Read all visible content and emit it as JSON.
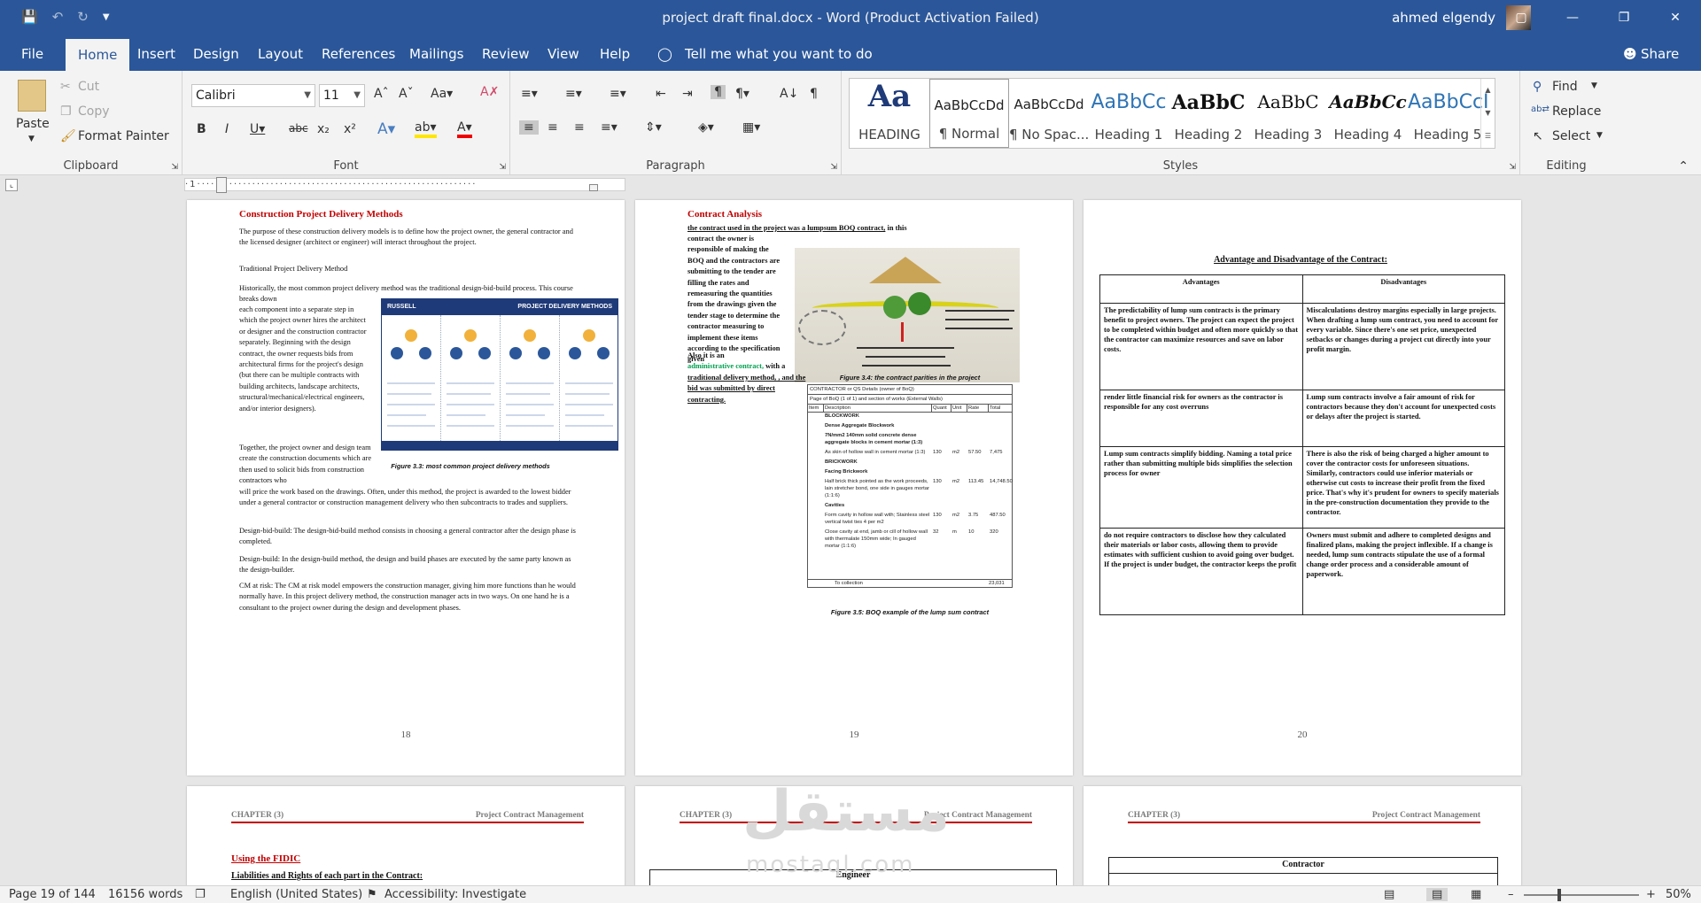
{
  "window": {
    "title": "project draft final.docx  -  Word (Product Activation Failed)",
    "user": "ahmed elgendy"
  },
  "tabs": [
    "File",
    "Home",
    "Insert",
    "Design",
    "Layout",
    "References",
    "Mailings",
    "Review",
    "View",
    "Help"
  ],
  "tell_me": "Tell me what you want to do",
  "share": "Share",
  "clipboard": {
    "paste": "Paste",
    "cut": "Cut",
    "copy": "Copy",
    "format_painter": "Format Painter",
    "label": "Clipboard"
  },
  "font": {
    "name": "Calibri",
    "size": "11",
    "label": "Font"
  },
  "paragraph": {
    "label": "Paragraph"
  },
  "styles": {
    "label": "Styles",
    "items": [
      {
        "preview": "Aa",
        "name": "HEADING"
      },
      {
        "preview": "AaBbCcDd",
        "name": "¶ Normal"
      },
      {
        "preview": "AaBbCcDd",
        "name": "¶ No Spac..."
      },
      {
        "preview": "AaBbCc",
        "name": "Heading 1"
      },
      {
        "preview": "AaBbC",
        "name": "Heading 2"
      },
      {
        "preview": "AaBbC",
        "name": "Heading 3"
      },
      {
        "preview": "AaBbCc",
        "name": "Heading 4"
      },
      {
        "preview": "AaBbCcI",
        "name": "Heading 5"
      }
    ]
  },
  "editing": {
    "find": "Find",
    "replace": "Replace",
    "select": "Select",
    "label": "Editing"
  },
  "page18": {
    "title": "Construction Project Delivery Methods",
    "intro": "The purpose of these construction delivery models is to define how the project owner, the general contractor and the licensed designer (architect or engineer) will interact throughout the project.",
    "sub": "Traditional Project Delivery Method",
    "p1a": "Historically, the most common project delivery method was the traditional design-bid-build process. This course breaks down",
    "p1b": "each component into a separate step in which the project owner hires the architect or designer and the construction contractor separately. Beginning with the design contract, the owner requests bids from architectural firms for the project's design (but there can be multiple contracts with building architects, landscape architects, structural/mechanical/electrical engineers, and/or interior designers).",
    "p2a": "Together, the project owner and design team create the construction documents which are then used to solicit bids from construction contractors who",
    "p2b": "will price the work based on the drawings. Often, under this method, the project is awarded to the lowest bidder under a general contractor or construction management delivery who then subcontracts to trades and suppliers.",
    "p3": "Design-bid-build: The design-bid-build method consists in choosing a general contractor after the design phase is completed.",
    "p4": "Design-build: In the design-build method, the design and build phases are executed by the same party known as the design-builder.",
    "p5": "CM at risk: The CM at risk model empowers the construction manager, giving him more functions than he would normally have. In this project delivery method, the construction manager acts in two ways. On one hand he is a consultant to the project owner during the design and development phases.",
    "figure": {
      "brand": "RUSSELL",
      "heading": "PROJECT DELIVERY METHODS"
    },
    "caption": "Figure 3.3: most common project delivery methods",
    "num": "18"
  },
  "page19": {
    "title": "Contract Analysis",
    "lead_u": "the contract used in the project was a lumpsum BOQ contract,",
    "lead_rest": " in this",
    "body": "contract the owner is responsible of making the BOQ and the contractors are submitting to the tender are filling the rates and remeasuring the quantities from the drawings given the tender stage to determine the contractor measuring to implement these items according to the specification given",
    "also_a": "Also it is an",
    "also_green": "administrative contract,",
    "also_b": " with a",
    "also_u": "traditional delivery method, , and the bid was submitted by direct contracting.",
    "fig4": "Figure 3.4: the contract parities in the project",
    "fig5": "Figure 3.5: BOQ example of the lump sum contract",
    "boq": {
      "h1": "CONTRACTOR or QS Details (owner of BoQ)",
      "h2": "Page of BoQ (1 of 1) and section of works (External Walls)",
      "cols": [
        "Item",
        "Description",
        "Quant",
        "Unit",
        "Rate",
        "Total"
      ],
      "rows": [
        {
          "d": "BLOCKWORK",
          "b": true
        },
        {
          "d": "Dense Aggregate Blockwork",
          "b": true
        },
        {
          "d": "7N/mm2 140mm solid concrete dense aggregate blocks in cement mortar (1:3)",
          "b": true
        },
        {
          "d": "As skin of hollow wall in cement mortar (1:3)",
          "q": "130",
          "u": "m2",
          "r": "57.50",
          "t": "7,475"
        },
        {
          "d": "BRICKWORK",
          "b": true
        },
        {
          "d": "Facing Brickwork",
          "b": true
        },
        {
          "d": "Half brick thick pointed as the work proceeds, lain stretcher bond, one side in gauges mortar (1:1:6)",
          "q": "130",
          "u": "m2",
          "r": "113.45",
          "t": "14,748.50"
        },
        {
          "d": "Cavities",
          "b": true
        },
        {
          "d": "Form cavity in hollow wall with; Stainless steel vertical twist ties 4 per m2",
          "q": "130",
          "u": "m2",
          "r": "3.75",
          "t": "487.50"
        },
        {
          "d": "Close cavity at end, jamb or cill of hollow wall with thermalate 150mm wide; In gauged mortar (1:1:6)",
          "q": "32",
          "u": "m",
          "r": "10",
          "t": "320"
        }
      ],
      "foot_label": "To collection",
      "foot_total": "23,031"
    },
    "num": "19"
  },
  "page20": {
    "title": "Advantage and Disadvantage of the Contract:",
    "headers": [
      "Advantages",
      "Disadvantages"
    ],
    "rows": [
      [
        "The predictability of lump sum contracts is the primary benefit to project owners. The project can expect the project to be completed within budget and often more quickly so that the contractor can maximize resources and save on labor costs.",
        "Miscalculations destroy margins especially in large projects. When drafting a lump sum contract, you need to account for every variable. Since there's one set price, unexpected setbacks or changes during a project cut directly into your profit margin."
      ],
      [
        "render little financial risk for owners as the contractor is responsible for any cost overruns",
        "Lump sum contracts involve a fair amount of risk for contractors because they don't account for unexpected costs or delays after the project is started."
      ],
      [
        "Lump sum contracts simplify bidding. Naming a total price rather than submitting multiple bids simplifies the selection process for owner",
        "There is also the risk of being charged a higher amount to cover the contractor costs for unforeseen situations. Similarly, contractors could use inferior materials or otherwise cut costs to increase their profit from the fixed price. That's why it's prudent for owners to specify materials in the pre-construction documentation they provide to the contractor."
      ],
      [
        "do not require contractors to disclose how they calculated their materials or labor costs, allowing them to provide estimates with sufficient cushion to avoid going over budget. If the project is under budget, the contractor keeps the profit",
        "Owners must submit and adhere to completed designs and finalized plans, making the project inflexible. If a change is needed, lump sum contracts stipulate the use of a formal change order process and a considerable amount of paperwork."
      ]
    ],
    "num": "20"
  },
  "page21": {
    "chapter": "CHAPTER (3)",
    "running": "Project Contract Management",
    "title": "Using the FIDIC",
    "sub": "Liabilities and Rights of each part in the Contract:"
  },
  "page22": {
    "chapter": "CHAPTER (3)",
    "running": "Project Contract Management",
    "table_head": "Engineer"
  },
  "page23": {
    "chapter": "CHAPTER (3)",
    "running": "Project Contract Management",
    "table_head": "Contractor"
  },
  "watermark": {
    "arabic": "مستقل",
    "latin": "mostaql.com"
  },
  "status": {
    "page": "Page 19 of 144",
    "words": "16156 words",
    "language": "English (United States)",
    "accessibility": "Accessibility: Investigate",
    "zoom": "50%"
  }
}
